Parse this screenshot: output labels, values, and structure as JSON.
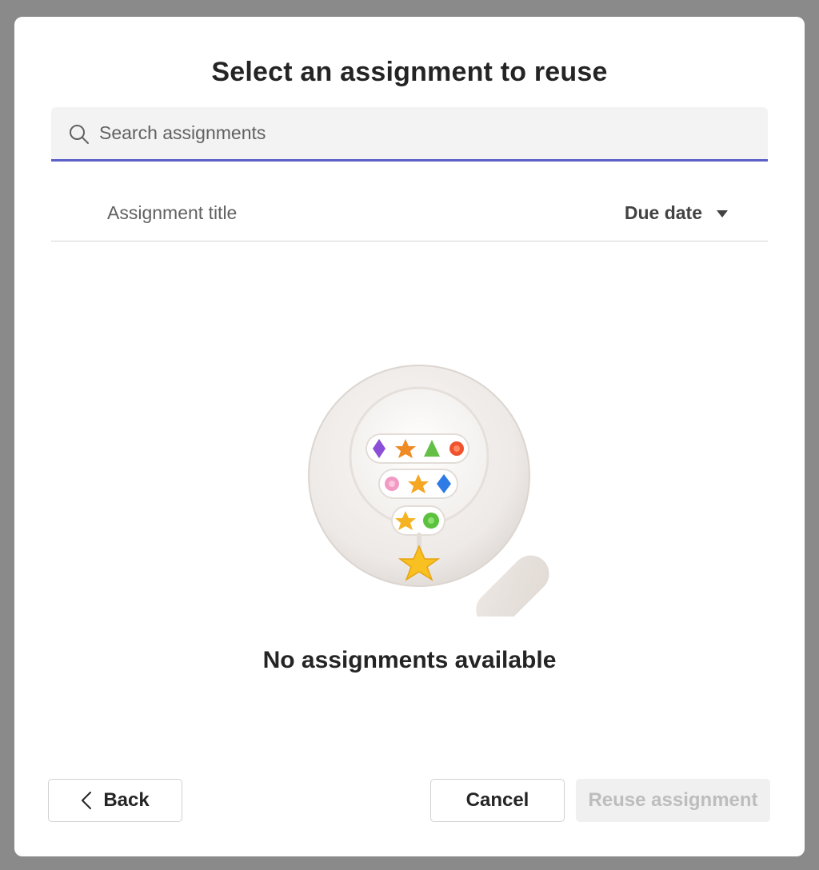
{
  "dialog": {
    "title": "Select an assignment to reuse"
  },
  "search": {
    "placeholder": "Search assignments",
    "value": "",
    "icon": "search-icon",
    "accent_color": "#5b5fc7"
  },
  "table": {
    "columns": {
      "title": "Assignment title",
      "due_date": "Due date",
      "sort_icon": "caret-down-icon"
    }
  },
  "empty_state": {
    "message": "No assignments available",
    "illustration": "magnifying-glass-illustration"
  },
  "footer": {
    "back_label": "Back",
    "back_icon": "chevron-left-icon",
    "cancel_label": "Cancel",
    "reuse_label": "Reuse assignment",
    "reuse_disabled": true
  }
}
